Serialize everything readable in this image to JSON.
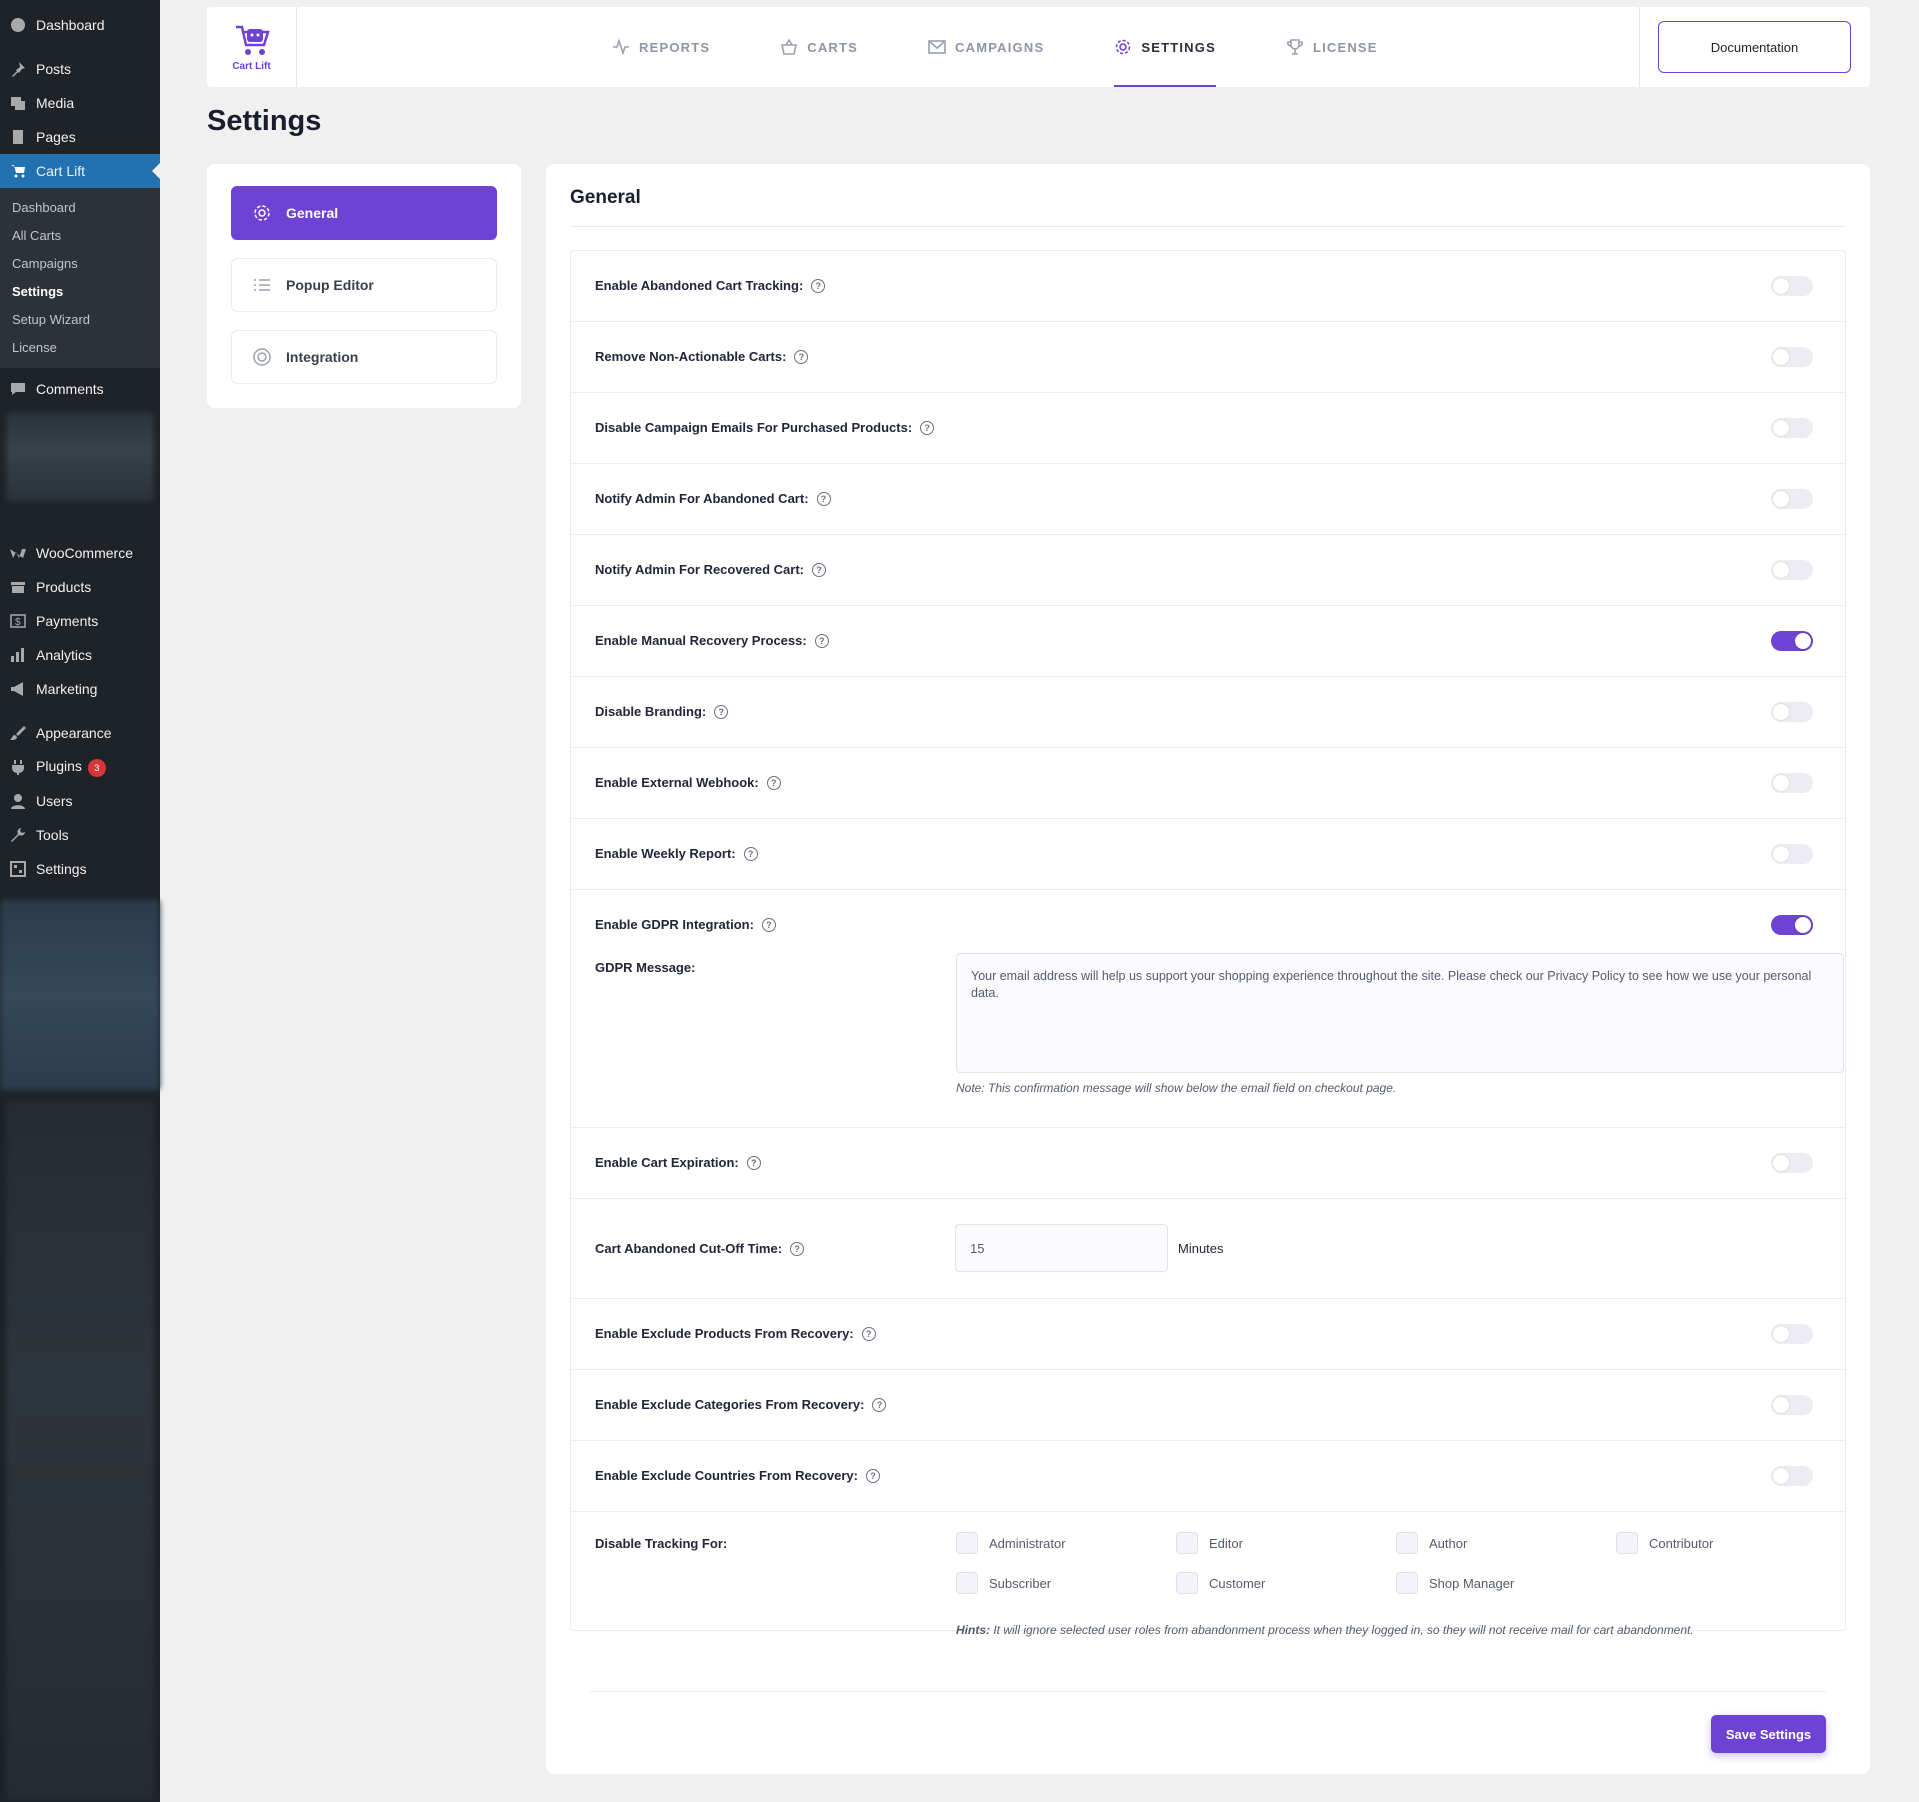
{
  "wp_menu": {
    "dashboard": "Dashboard",
    "posts": "Posts",
    "media": "Media",
    "pages": "Pages",
    "cartlift": "Cart Lift",
    "submenu": [
      "Dashboard",
      "All Carts",
      "Campaigns",
      "Settings",
      "Setup Wizard",
      "License"
    ],
    "comments": "Comments",
    "woocommerce": "WooCommerce",
    "products": "Products",
    "payments": "Payments",
    "analytics": "Analytics",
    "marketing": "Marketing",
    "appearance": "Appearance",
    "plugins": "Plugins",
    "plugins_badge": "3",
    "users": "Users",
    "tools": "Tools",
    "settings": "Settings"
  },
  "topnav": {
    "logo_text": "Cart Lift",
    "tabs": [
      "REPORTS",
      "CARTS",
      "CAMPAIGNS",
      "SETTINGS",
      "LICENSE"
    ],
    "active_tab": "SETTINGS",
    "documentation": "Documentation"
  },
  "page_title": "Settings",
  "settings_menu": [
    "General",
    "Popup Editor",
    "Integration"
  ],
  "panel": {
    "title": "General",
    "rows": [
      {
        "label": "Enable Abandoned Cart Tracking:",
        "on": false
      },
      {
        "label": "Remove Non-Actionable Carts:",
        "on": false
      },
      {
        "label": "Disable Campaign Emails For Purchased Products:",
        "on": false
      },
      {
        "label": "Notify Admin For Abandoned Cart:",
        "on": false
      },
      {
        "label": "Notify Admin For Recovered Cart:",
        "on": false
      },
      {
        "label": "Enable Manual Recovery Process:",
        "on": true
      },
      {
        "label": "Disable Branding:",
        "on": false
      },
      {
        "label": "Enable External Webhook:",
        "on": false
      },
      {
        "label": "Enable Weekly Report:",
        "on": false
      },
      {
        "label": "Enable GDPR Integration:",
        "on": true
      }
    ],
    "gdpr_message_label": "GDPR Message:",
    "gdpr_message": "Your email address will help us support your shopping experience throughout the site. Please check our Privacy Policy to see how we use your personal data.",
    "gdpr_note": "Note: This confirmation message will show below the email field on checkout page.",
    "cart_expiration_label": "Enable Cart Expiration:",
    "cutoff_label": "Cart Abandoned Cut-Off Time:",
    "cutoff_value": "15",
    "cutoff_unit": "Minutes",
    "exclude_rows": [
      {
        "label": "Enable Exclude Products From Recovery:",
        "on": false
      },
      {
        "label": "Enable Exclude Categories From Recovery:",
        "on": false
      },
      {
        "label": "Enable Exclude Countries From Recovery:",
        "on": false
      }
    ],
    "disable_tracking_label": "Disable Tracking For:",
    "roles": [
      "Administrator",
      "Editor",
      "Author",
      "Contributor",
      "Subscriber",
      "Customer",
      "Shop Manager"
    ],
    "hint_prefix": "Hints:",
    "hint_text": " It will ignore selected user roles from abandonment process when they logged in, so they will not receive mail for cart abandonment.",
    "save_button": "Save Settings"
  },
  "colors": {
    "accent": "#6e42d3",
    "wp_sidebar": "#1d2327",
    "wp_active": "#2271b1"
  }
}
